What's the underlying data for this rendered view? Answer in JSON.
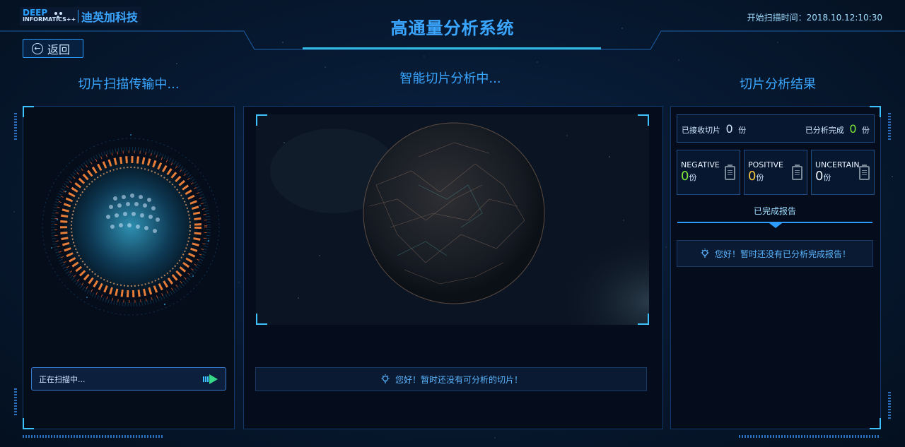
{
  "header": {
    "logo_en_line1": "DEEP",
    "logo_en_line2": "INFORMATICS++",
    "logo_cn": "迪英加科技",
    "title": "高通量分析系统",
    "scan_time_label": "开始扫描时间：",
    "scan_time_value": "2018.10.12:10:30"
  },
  "nav": {
    "back_label": "返回"
  },
  "left_panel": {
    "title": "切片扫描传输中...",
    "status_text": "正在扫描中..."
  },
  "middle_panel": {
    "title": "智能切片分析中...",
    "notice": "您好！暂时还没有可分析的切片！"
  },
  "right_panel": {
    "title": "切片分析结果",
    "received_label": "已接收切片",
    "received_count": "0",
    "received_unit": "份",
    "analyzed_label": "已分析完成",
    "analyzed_count": "0",
    "analyzed_unit": "份",
    "stats": [
      {
        "label": "NEGATIVE",
        "value": "0",
        "unit": "份",
        "color": "#7fe63a"
      },
      {
        "label": "POSITIVE",
        "value": "0",
        "unit": "份",
        "color": "#f5c842"
      },
      {
        "label": "UNCERTAIN",
        "value": "0",
        "unit": "份",
        "color": "#e8eef5"
      }
    ],
    "report_tab": "已完成报告",
    "report_notice": "您好！暂时还没有已分析完成报告！"
  },
  "colors": {
    "accent": "#3aa6ff",
    "background": "#061328",
    "positive_green": "#7fe63a",
    "warning_yellow": "#f5c842"
  },
  "icons": [
    "back-arrow-icon",
    "play-arrow-icon",
    "lightbulb-icon",
    "clipboard-icon"
  ]
}
